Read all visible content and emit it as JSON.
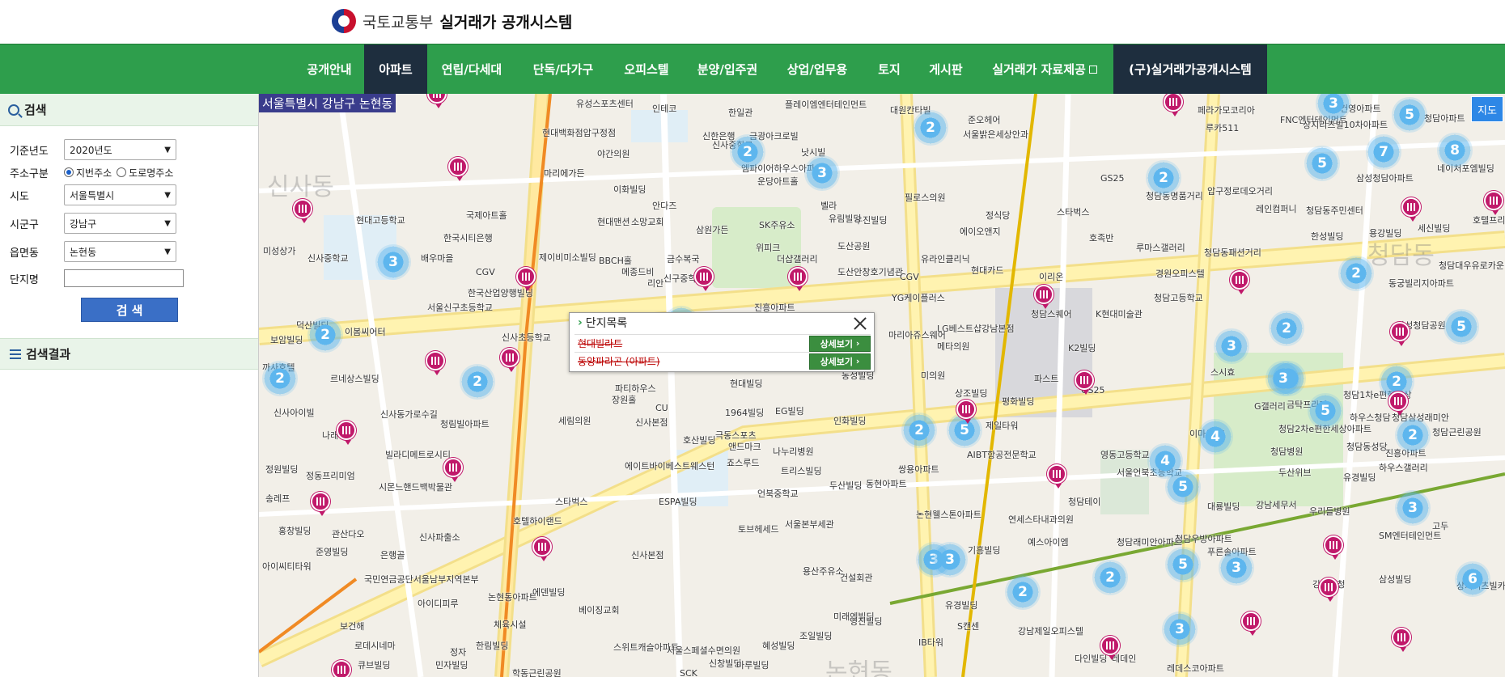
{
  "header": {
    "org": "국토교통부",
    "title": "실거래가 공개시스템"
  },
  "nav": {
    "items": [
      {
        "label": "공개안내",
        "active": false
      },
      {
        "label": "아파트",
        "active": true
      },
      {
        "label": "연립/다세대",
        "active": false
      },
      {
        "label": "단독/다가구",
        "active": false
      },
      {
        "label": "오피스텔",
        "active": false
      },
      {
        "label": "분양/입주권",
        "active": false
      },
      {
        "label": "상업/업무용",
        "active": false
      },
      {
        "label": "토지",
        "active": false
      },
      {
        "label": "게시판",
        "active": false
      },
      {
        "label": "실거래가 자료제공",
        "active": false
      },
      {
        "label": "(구)실거래가공개시스템",
        "active": false
      }
    ]
  },
  "sidebar": {
    "search_title": "검색",
    "year_label": "기준년도",
    "year_value": "2020년도",
    "addr_label": "주소구분",
    "addr_opt1": "지번주소",
    "addr_opt2": "도로명주소",
    "sido_label": "시도",
    "sido_value": "서울특별시",
    "sigungu_label": "시군구",
    "sigungu_value": "강남구",
    "dong_label": "읍면동",
    "dong_value": "논현동",
    "complex_label": "단지명",
    "complex_value": "",
    "search_button": "검 색",
    "results_title": "검색결과"
  },
  "map": {
    "region_label": "서울특별시 강남구 논현동",
    "map_button": "지도",
    "popup": {
      "title": "단지목록",
      "rows": [
        {
          "name": "현대빌라트",
          "button": "상세보기"
        },
        {
          "name": "동양파라곤 (아파트)",
          "button": "상세보기"
        }
      ]
    },
    "clusters": [
      "3",
      "5",
      "7",
      "8",
      "2",
      "3",
      "2",
      "2",
      "5",
      "2",
      "5",
      "2",
      "2",
      "2",
      "2",
      "2",
      "2",
      "3",
      "3",
      "5",
      "2",
      "3",
      "4",
      "2",
      "5",
      "2",
      "5",
      "3",
      "3",
      "2",
      "5",
      "3",
      "4",
      "3",
      "6",
      "3",
      "2"
    ],
    "dong_names": [
      "신사동",
      "청담동",
      "논현동"
    ],
    "place_labels": [
      "유성스포츠센터",
      "현대백화점압구정점",
      "인테코",
      "한일관",
      "플레이엠엔터테인먼트",
      "대원칸타빌",
      "준오헤어",
      "한국시티은행",
      "신사중학교",
      "현대고등학교",
      "미성상가",
      "신사중학교",
      "배우마을",
      "도산공원",
      "도산안창호기념관",
      "SK주유소",
      "더샵갤러리",
      "서울신구초등학교",
      "한국산업양행빌딩",
      "신사초등학교",
      "이봄씨어터",
      "덕산빌딩",
      "보암빌딩",
      "까사호텔",
      "르네상스빌딩",
      "신사아이빌",
      "청림빌아파트",
      "신사동가로수길",
      "나래",
      "빌라디메트로시티",
      "정원빌딩",
      "정동프리미엄",
      "송레프",
      "시몬느핸드백박물관",
      "홍창빌딩",
      "관산다오",
      "준영빌딩",
      "은행골",
      "신사파출소",
      "아이씨티타워",
      "국민연금공단서울남부지역본부",
      "아이디피루",
      "보건해",
      "로데시네마",
      "큐브빌딩",
      "민자빌딩",
      "한림빌딩",
      "체육시설",
      "정자",
      "학동근린공원",
      "논현동아파트",
      "에덴빌딩",
      "베이징교회",
      "스위트캐슬아파트",
      "서울스페셜수면의원",
      "신창빌딩",
      "SCK",
      "마루빌딩",
      "혜성빌딩",
      "조일빌딩",
      "미래엔빌딩",
      "용산주유소",
      "건설회관",
      "영진빌딩",
      "IB타워",
      "유경빌딩",
      "S캔센",
      "강남제일오피스텔",
      "다인빌딩",
      "레데인",
      "레데스코아파트",
      "파티하우스",
      "세림의원",
      "신사본점",
      "1964빌딩",
      "EG빌딩",
      "인화빌딩",
      "호산빌딩",
      "앤드마크",
      "나누리병원",
      "트리스빌딩",
      "두산빌딩",
      "죠스루드",
      "에이트바이베스트웨스턴",
      "ESPA빌딩",
      "스타벅스",
      "호텔하이랜드",
      "토브헤세드",
      "서울본부세관",
      "언북중학교",
      "동현아파트",
      "쌍용아파트",
      "논현웰스톤아파트",
      "기흥빌딩",
      "예스아이엠",
      "연세스타내과의원",
      "AIBT항공전문학교",
      "LG베스트샵강남본점",
      "영동고등학교",
      "서울언북초등학교",
      "청담테이",
      "청담래미안아파트",
      "청담우방아파트",
      "푸른솔아파트",
      "대룡빌딩",
      "강남세무서",
      "우리들병원",
      "SM엔터테인먼트",
      "고두",
      "상지리츠빌카일룸아파트",
      "강남구청",
      "청담근린공원",
      "삼성청담공원",
      "삼성빌딩",
      "청담동성당",
      "진흥아파트",
      "유경빌딩",
      "하우스갤러리",
      "하우스청담",
      "청담삼성래미안",
      "두산위브",
      "청담1차e편한세상",
      "청담2차e편한세상아파트",
      "청담병원",
      "이마트24",
      "G갤러리",
      "금탁프라자",
      "스시효",
      "파스트",
      "GS25",
      "K2빌딩",
      "청담스퀘어",
      "K현대미술관",
      "현대카드",
      "이리온",
      "경원오피스텔",
      "청담고등학교",
      "페라가모코리아",
      "루카511",
      "FNC엔터테인먼트",
      "건영아파트",
      "청담아파트",
      "상지리츠빌10차아파트",
      "삼성청담아파트",
      "네이처포엠빌딩",
      "레인컴퍼니",
      "청담동주민센터",
      "한성빌딩",
      "용강빌딩",
      "세신빌딩",
      "호텔프리마",
      "청담대우유로카운티아파트",
      "동궁빌리지아파트",
      "루마스갤러리",
      "청담동패션거리",
      "청담동명품거리",
      "압구정로데오거리",
      "서울밝은세상안과",
      "정식당",
      "스타벅스",
      "GS25",
      "호족반",
      "우진빌딩",
      "필로스의원",
      "에이오앤지",
      "유라인클리닉",
      "CGV",
      "YG케이플러스",
      "마리아쥬스웨어",
      "메타의원",
      "동성빌딩",
      "미의원",
      "상조빌딩",
      "평화빌딩",
      "제일타워",
      "현대빌딩",
      "신사본점",
      "CU",
      "극동스포츠",
      "국제아트홀",
      "마리에가든",
      "야간의원",
      "이화빌딩",
      "안다즈",
      "현대맨션",
      "소망교회",
      "삼원가든",
      "위피크",
      "금수복국",
      "진흥아파트",
      "신구중학교",
      "신한은행",
      "금광아크로빌",
      "낫시빌",
      "운당아트홀",
      "엠파이어하우스아파트",
      "벨라",
      "유림빌딩",
      "장원홀",
      "제이비미소빌딩",
      "BBCH홀",
      "CGV",
      "메종드비",
      "리안"
    ]
  }
}
